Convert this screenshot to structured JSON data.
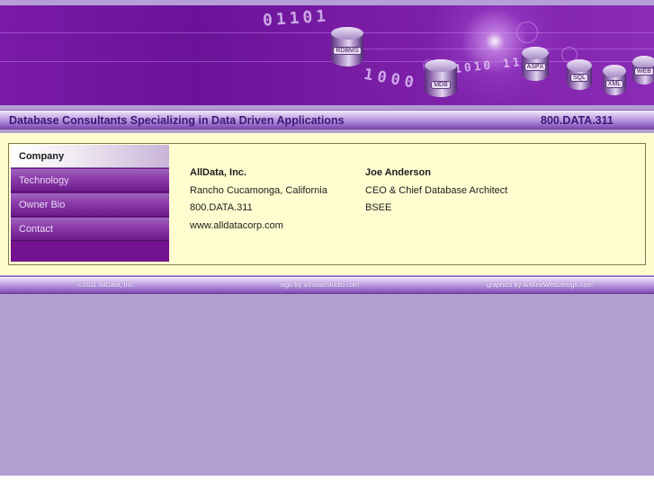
{
  "header": {
    "binary_text_1": "01101",
    "binary_text_2": "1000",
    "binary_text_3": "1010 11",
    "db_labels": [
      "RDBMS",
      "MDB",
      "ASPX",
      "SQL",
      "XML",
      "WEB"
    ]
  },
  "tagline": {
    "text": "Database Consultants Specializing in Data Driven Applications",
    "phone": "800.DATA.311"
  },
  "nav": {
    "items": [
      {
        "label": "Company"
      },
      {
        "label": "Technology"
      },
      {
        "label": "Owner Bio"
      },
      {
        "label": "Contact"
      }
    ]
  },
  "company": {
    "name": "AllData, Inc.",
    "location": "Rancho Cucamonga, California",
    "phone": "800.DATA.311",
    "website": "www.alldatacorp.com"
  },
  "owner": {
    "name": "Joe Anderson",
    "title": "CEO & Chief Database Architect",
    "degree": "BSEE"
  },
  "footer": {
    "copyright": "©2011 AllData, Inc.",
    "logo_credit": "logo by aVisualStudio.com",
    "graphics_credit": "graphics by ArtAndWebDesign.com"
  },
  "colors": {
    "background": "#b29ed0",
    "banner": "#6a1398",
    "content": "#fefccc",
    "nav": "#72128f",
    "tagline_text": "#3a1678"
  }
}
